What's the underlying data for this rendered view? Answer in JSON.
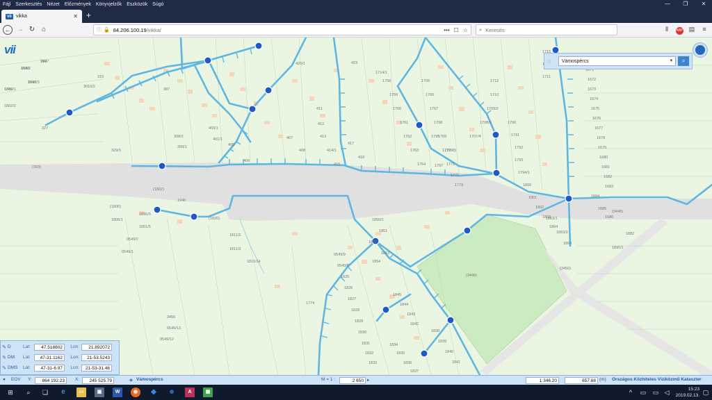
{
  "browser": {
    "menu": [
      "Fájl",
      "Szerkesztés",
      "Nézet",
      "Előzmények",
      "Könyvjelzők",
      "Eszközök",
      "Súgó"
    ],
    "window_controls": [
      "—",
      "❐",
      "✕"
    ],
    "tab_title": "vikka",
    "tab_favicon": "vii",
    "newtab": "+",
    "url_host": "84.206.100.19",
    "url_path": "/vikka/",
    "url_actions": [
      "•••",
      "☐",
      "☆"
    ],
    "search_placeholder": "Keresés"
  },
  "app": {
    "logo": "vii",
    "search_select_value": "Vámospércs",
    "search_button_icon": "search-icon"
  },
  "coords": {
    "rows": [
      {
        "name": "D",
        "lat": "47.518602",
        "lon": "21.892072"
      },
      {
        "name": "DM",
        "lat": "47-31.1162",
        "lon": "21-53.5243"
      },
      {
        "name": "DMS",
        "lat": "47-31-6.97",
        "lon": "21-53-31.46"
      }
    ],
    "lat_label": "Lat:",
    "lon_label": "Lon:"
  },
  "status": {
    "eov_label": "EOV",
    "y_label": "Y:",
    "y_value": "864 192.23",
    "x_label": "X:",
    "x_value": "245 525.79",
    "settlement": "Vámospércs",
    "scale_label": "M = 1 :",
    "scale_value": "2 650",
    "value_a": "1 346.20",
    "value_b": "657.68",
    "unit": "(m)",
    "credit": "Országos Közhiteles Víziközmű Kataszter"
  },
  "taskbar": {
    "time": "15:23",
    "date": "2019.02.13."
  },
  "map": {
    "parcel_labels": [
      "318/3",
      "249",
      "3010/3",
      "1802/1",
      "1802/2",
      "327",
      "315",
      "3010/2",
      "329/3",
      "387",
      "420/1",
      "423",
      "1714/1",
      "1715",
      "1716",
      "1711",
      "1712",
      "1710",
      "1709/2",
      "1708/2",
      "1707/4",
      "1790",
      "1791",
      "1792",
      "1793",
      "1794/1",
      "1800",
      "1801",
      "1802",
      "1803",
      "1804",
      "1670",
      "1671",
      "1672",
      "1673",
      "1674",
      "1675",
      "1676",
      "1677",
      "1678",
      "1679",
      "1680",
      "1681",
      "1682",
      "1683",
      "1684",
      "1685",
      "1686",
      "(303)",
      "(1802)",
      "(1806)",
      "1806/1",
      "1940",
      "1855/3",
      "1851/5",
      "0549/2",
      "0549/1",
      "1811/2",
      "1811/3",
      "1811/14",
      "(1820)",
      "1850/1",
      "1851",
      "1852",
      "1853",
      "1854",
      "1863/1",
      "1863/2",
      "1864",
      "(3449)",
      "(3450)",
      "(3448)",
      "1882",
      "1890/1",
      "398/2",
      "399/1",
      "400/1",
      "401/1",
      "405",
      "406",
      "407",
      "408",
      "411",
      "412",
      "413",
      "414/1",
      "415",
      "417",
      "418",
      "1795",
      "(1798)",
      "1797",
      "1758",
      "1759",
      "1760",
      "1761",
      "1762",
      "1763",
      "1764",
      "1765",
      "1766",
      "1767",
      "1768",
      "1769",
      "1770",
      "1771",
      "1772",
      "1773",
      "1774",
      "3456",
      "0549/13",
      "0549/12",
      "0549/9",
      "0549/8",
      "1825",
      "1826",
      "1827",
      "1828",
      "1829",
      "1830",
      "1831",
      "1832",
      "1833",
      "1834",
      "1835",
      "1836",
      "1837",
      "1838",
      "1839",
      "1840",
      "1841",
      "1842",
      "1843",
      "1844",
      "1845",
      "1846",
      "1847",
      "1848",
      "1849"
    ],
    "colors": {
      "pipe": "#5fb6e0",
      "node": "#1f59c4",
      "road": "#e2e2e2",
      "ground": "#eaf5e2",
      "field": "#cdebc3",
      "house": "#f6d5b8"
    }
  }
}
